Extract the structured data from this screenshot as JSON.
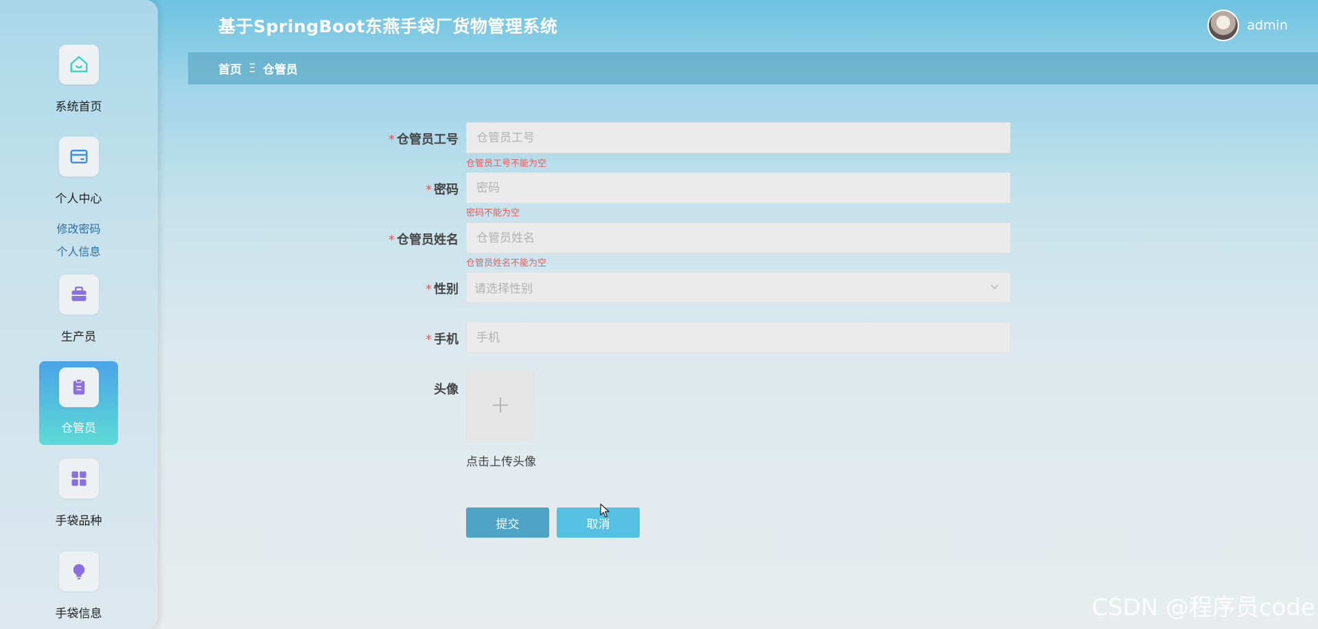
{
  "app": {
    "title": "基于SpringBoot东燕手袋厂货物管理系统"
  },
  "user": {
    "name": "admin",
    "avatar_icon": "user-avatar"
  },
  "sidebar": {
    "items": [
      {
        "label": "系统首页",
        "icon": "home-icon",
        "color": "#3ad4c0"
      },
      {
        "label": "个人中心",
        "icon": "card-icon",
        "color": "#3b8fe6",
        "subitems": [
          "修改密码",
          "个人信息"
        ]
      },
      {
        "label": "生产员",
        "icon": "briefcase-icon",
        "color": "#8a6fe0"
      },
      {
        "label": "仓管员",
        "icon": "clipboard-icon",
        "color": "#8a6fe0",
        "active": true
      },
      {
        "label": "手袋品种",
        "icon": "grid-icon",
        "color": "#8a6fe0"
      },
      {
        "label": "手袋信息",
        "icon": "bulb-icon",
        "color": "#8a6fe0"
      }
    ]
  },
  "breadcrumb": {
    "home": "首页",
    "separator": "Ξ",
    "current": "仓管员"
  },
  "form": {
    "required_mark": "*",
    "employee_id": {
      "label": "仓管员工号",
      "placeholder": "仓管员工号",
      "value": "",
      "error": "仓管员工号不能为空"
    },
    "password": {
      "label": "密码",
      "placeholder": "密码",
      "value": "",
      "error": "密码不能为空"
    },
    "name": {
      "label": "仓管员姓名",
      "placeholder": "仓管员姓名",
      "value": "",
      "error": "仓管员姓名不能为空"
    },
    "gender": {
      "label": "性别",
      "placeholder": "请选择性别"
    },
    "phone": {
      "label": "手机",
      "placeholder": "手机",
      "value": ""
    },
    "avatar": {
      "label": "头像",
      "hint": "点击上传头像"
    },
    "submit_label": "提交",
    "cancel_label": "取消"
  },
  "watermark": "CSDN @程序员code",
  "colors": {
    "accent": "#4fa3c6",
    "cancel": "#55c1e2",
    "error": "#e06060",
    "required": "#e05a5a"
  }
}
